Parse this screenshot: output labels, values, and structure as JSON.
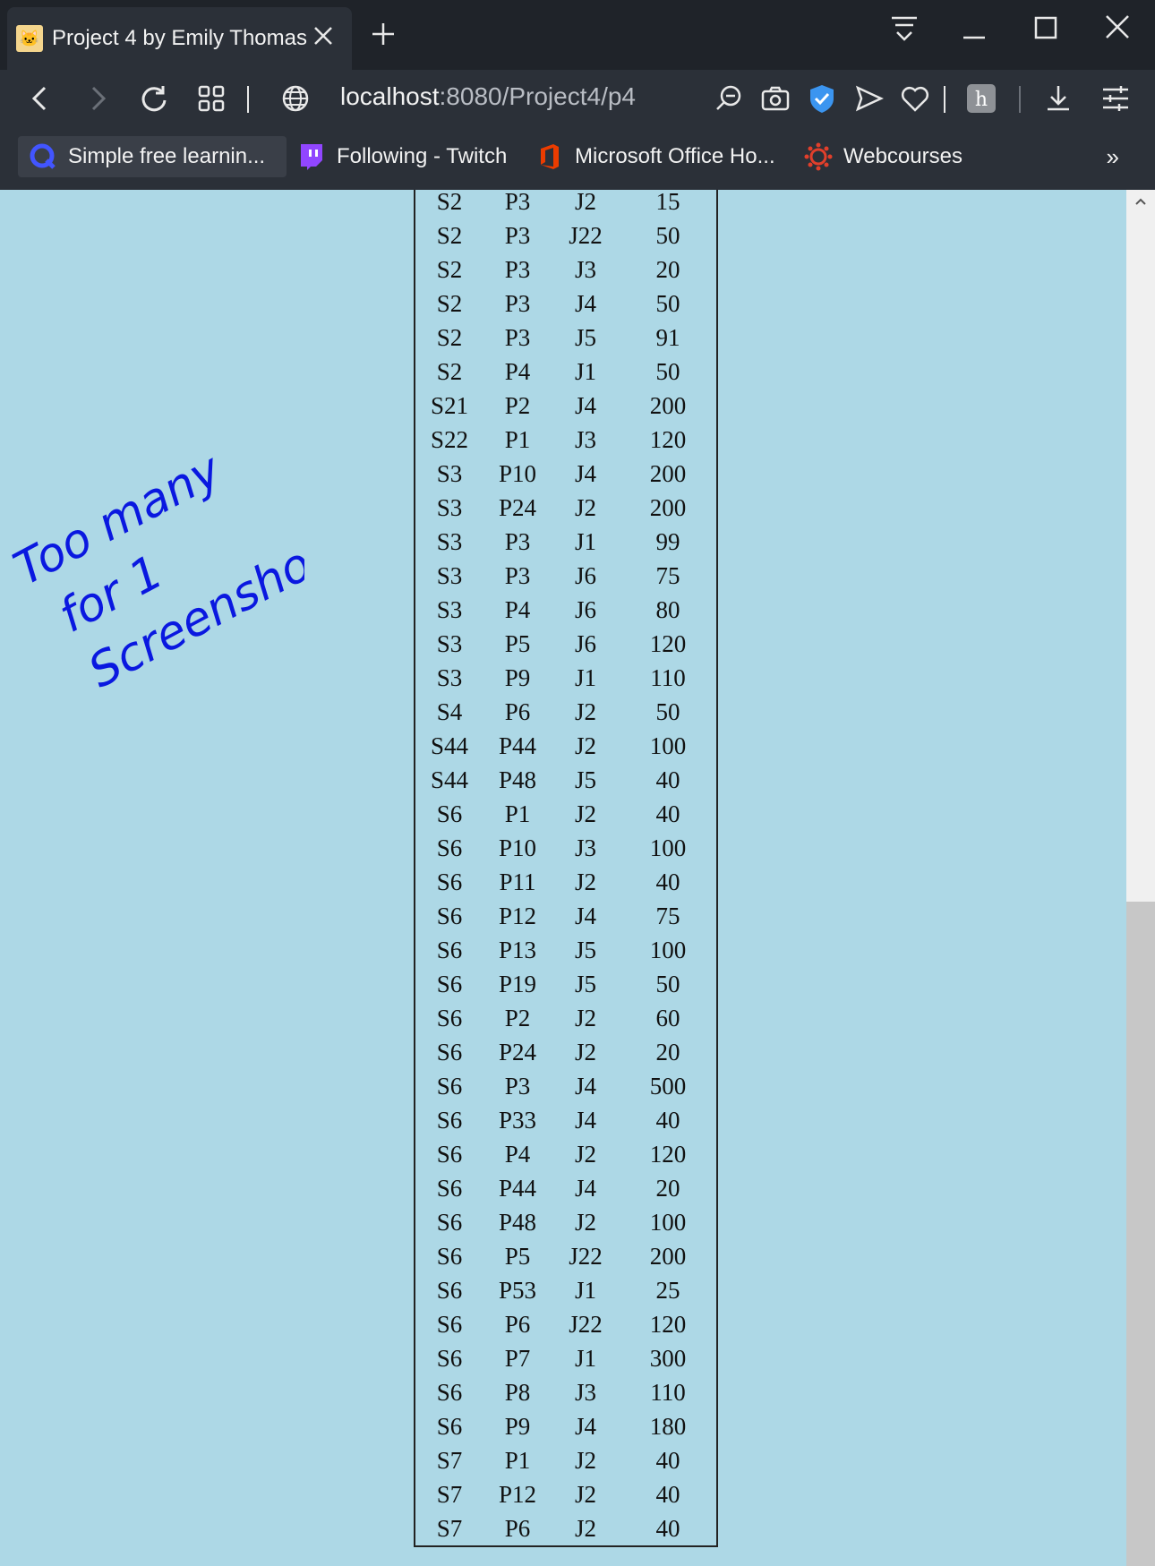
{
  "browser": {
    "tab_title": "Project 4 by Emily Thomas",
    "url_host": "localhost",
    "url_path": ":8080/Project4/p4",
    "bookmarks": [
      {
        "label": "Simple free learnin...",
        "icon": "quizlet-icon"
      },
      {
        "label": "Following - Twitch",
        "icon": "twitch-icon"
      },
      {
        "label": "Microsoft Office Ho...",
        "icon": "office-icon"
      },
      {
        "label": "Webcourses",
        "icon": "canvas-icon"
      }
    ],
    "overflow_label": "»"
  },
  "annotation": {
    "line1": "Too many",
    "line2": "for 1",
    "line3": "Screenshot",
    "color": "#0a18e0"
  },
  "table": {
    "rows": [
      [
        "S2",
        "P3",
        "J2",
        "15"
      ],
      [
        "S2",
        "P3",
        "J22",
        "50"
      ],
      [
        "S2",
        "P3",
        "J3",
        "20"
      ],
      [
        "S2",
        "P3",
        "J4",
        "50"
      ],
      [
        "S2",
        "P3",
        "J5",
        "91"
      ],
      [
        "S2",
        "P4",
        "J1",
        "50"
      ],
      [
        "S21",
        "P2",
        "J4",
        "200"
      ],
      [
        "S22",
        "P1",
        "J3",
        "120"
      ],
      [
        "S3",
        "P10",
        "J4",
        "200"
      ],
      [
        "S3",
        "P24",
        "J2",
        "200"
      ],
      [
        "S3",
        "P3",
        "J1",
        "99"
      ],
      [
        "S3",
        "P3",
        "J6",
        "75"
      ],
      [
        "S3",
        "P4",
        "J6",
        "80"
      ],
      [
        "S3",
        "P5",
        "J6",
        "120"
      ],
      [
        "S3",
        "P9",
        "J1",
        "110"
      ],
      [
        "S4",
        "P6",
        "J2",
        "50"
      ],
      [
        "S44",
        "P44",
        "J2",
        "100"
      ],
      [
        "S44",
        "P48",
        "J5",
        "40"
      ],
      [
        "S6",
        "P1",
        "J2",
        "40"
      ],
      [
        "S6",
        "P10",
        "J3",
        "100"
      ],
      [
        "S6",
        "P11",
        "J2",
        "40"
      ],
      [
        "S6",
        "P12",
        "J4",
        "75"
      ],
      [
        "S6",
        "P13",
        "J5",
        "100"
      ],
      [
        "S6",
        "P19",
        "J5",
        "50"
      ],
      [
        "S6",
        "P2",
        "J2",
        "60"
      ],
      [
        "S6",
        "P24",
        "J2",
        "20"
      ],
      [
        "S6",
        "P3",
        "J4",
        "500"
      ],
      [
        "S6",
        "P33",
        "J4",
        "40"
      ],
      [
        "S6",
        "P4",
        "J2",
        "120"
      ],
      [
        "S6",
        "P44",
        "J4",
        "20"
      ],
      [
        "S6",
        "P48",
        "J2",
        "100"
      ],
      [
        "S6",
        "P5",
        "J22",
        "200"
      ],
      [
        "S6",
        "P53",
        "J1",
        "25"
      ],
      [
        "S6",
        "P6",
        "J22",
        "120"
      ],
      [
        "S6",
        "P7",
        "J1",
        "300"
      ],
      [
        "S6",
        "P8",
        "J3",
        "110"
      ],
      [
        "S6",
        "P9",
        "J4",
        "180"
      ],
      [
        "S7",
        "P1",
        "J2",
        "40"
      ],
      [
        "S7",
        "P12",
        "J2",
        "40"
      ],
      [
        "S7",
        "P6",
        "J2",
        "40"
      ]
    ]
  }
}
